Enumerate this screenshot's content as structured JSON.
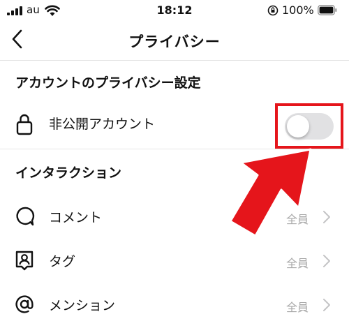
{
  "status_bar": {
    "carrier": "au",
    "time": "18:12",
    "battery_percent": "100%",
    "icons": [
      "signal-icon",
      "wifi-icon",
      "orientation-lock-icon",
      "battery-icon"
    ]
  },
  "nav": {
    "title": "プライバシー",
    "back_icon": "chevron-left-icon"
  },
  "account_privacy": {
    "header": "アカウントのプライバシー設定",
    "private_account": {
      "label": "非公開アカウント",
      "icon": "lock-icon",
      "toggle_on": false
    }
  },
  "interactions": {
    "header": "インタラクション",
    "items": [
      {
        "label": "コメント",
        "value": "全員",
        "icon": "comment-icon"
      },
      {
        "label": "タグ",
        "value": "全員",
        "icon": "tag-person-icon"
      },
      {
        "label": "メンション",
        "value": "全員",
        "icon": "mention-at-icon"
      }
    ]
  },
  "colors": {
    "annotation_red": "#e5151b",
    "toggle_off_track": "#e1e1e3",
    "secondary_text": "#a9a9a9"
  }
}
